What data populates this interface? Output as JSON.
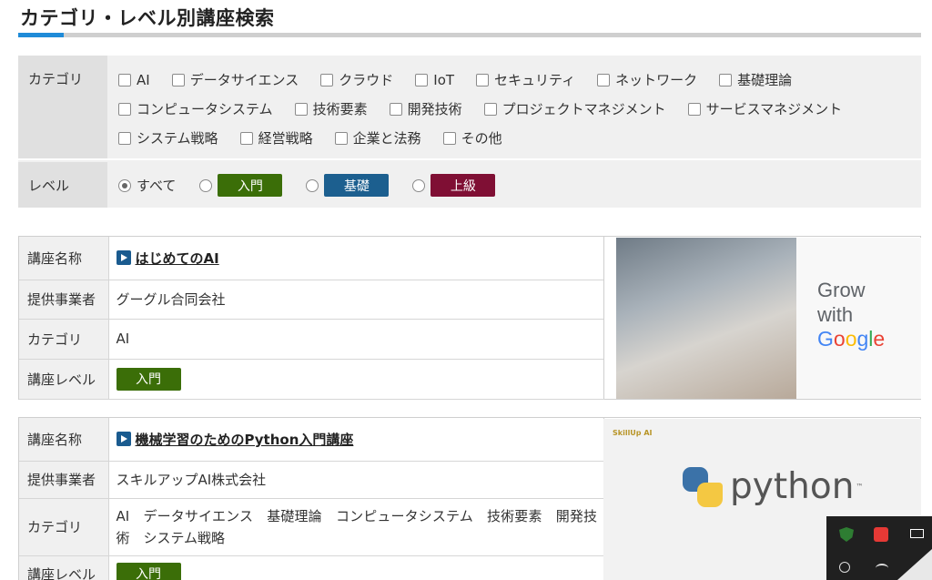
{
  "page": {
    "title": "カテゴリ・レベル別講座検索"
  },
  "filters": {
    "category_label": "カテゴリ",
    "level_label": "レベル",
    "categories_row1": [
      "AI",
      "データサイエンス",
      "クラウド",
      "IoT",
      "セキュリティ",
      "ネットワーク",
      "基礎理論"
    ],
    "categories_row2": [
      "コンピュータシステム",
      "技術要素",
      "開発技術",
      "プロジェクトマネジメント",
      "サービスマネジメント"
    ],
    "categories_row3": [
      "システム戦略",
      "経営戦略",
      "企業と法務",
      "その他"
    ],
    "levels": {
      "all": "すべて",
      "beginner": "入門",
      "basic": "基礎",
      "advanced": "上級"
    },
    "level_colors": {
      "beginner": "#3b6e08",
      "basic": "#1c5f8f",
      "advanced": "#7f0f34"
    }
  },
  "courses": [
    {
      "name_label": "講座名称",
      "provider_label": "提供事業者",
      "category_label": "カテゴリ",
      "level_label": "講座レベル",
      "title": "はじめてのAI",
      "provider": "グーグル合同会社",
      "categories": "AI",
      "level": "入門",
      "promo": {
        "grow": "Grow",
        "with": "with",
        "google": "Google"
      }
    },
    {
      "name_label": "講座名称",
      "provider_label": "提供事業者",
      "category_label": "カテゴリ",
      "level_label": "講座レベル",
      "title": "機械学習のためのPython入門講座",
      "provider": "スキルアップAI株式会社",
      "categories": "AI　データサイエンス　基礎理論　コンピュータシステム　技術要素　開発技術　システム戦略",
      "level": "入門",
      "promo": {
        "logo_text": "SkillUp AI",
        "python": "python",
        "tm": "™"
      }
    }
  ],
  "colors": {
    "accent": "#1f8bd8",
    "google_blue": "#4285F4",
    "google_red": "#EA4335",
    "google_yellow": "#FBBC05",
    "google_green": "#34A853"
  }
}
